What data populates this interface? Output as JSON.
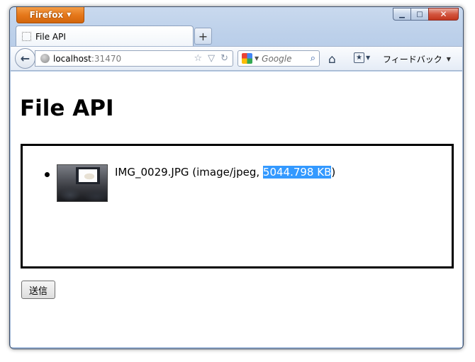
{
  "browser": {
    "app_button_label": "Firefox",
    "tab": {
      "title": "File API"
    },
    "address": {
      "host": "localhost",
      "port": ":31470"
    },
    "search": {
      "engine_icon": "google-icon",
      "placeholder": "Google"
    },
    "feedback_label": "フィードバック"
  },
  "page": {
    "title": "File API",
    "file": {
      "name_prefix": "IMG_0029.JPG (image/jpeg, ",
      "size_highlighted": "5044.798 KB",
      "suffix": ")"
    },
    "submit_label": "送信"
  },
  "colors": {
    "selection": "#3399ff",
    "firefox_button": "#e5771a"
  }
}
